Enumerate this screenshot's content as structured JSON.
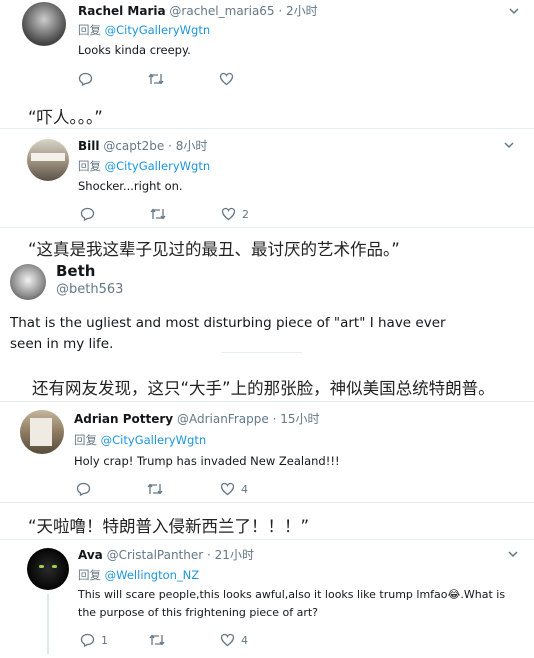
{
  "tweets": [
    {
      "name": "Rachel Maria",
      "handle": "@rachel_maria65",
      "time": "2小时",
      "reply_prefix": "回复",
      "reply_to": "@CityGalleryWgtn",
      "text": "Looks kinda creepy.",
      "reply_count": "",
      "like_count": ""
    },
    {
      "name": "Bill",
      "handle": "@capt2be",
      "time": "8小时",
      "reply_prefix": "回复",
      "reply_to": "@CityGalleryWgtn",
      "text": "Shocker...right on.",
      "reply_count": "",
      "like_count": "2"
    },
    {
      "name": "Beth",
      "handle": "@beth563",
      "text_line1": "That is the ugliest and most disturbing piece of \"art\" I have ever",
      "text_line2": "seen in my life."
    },
    {
      "name": "Adrian Pottery",
      "handle": "@AdrianFrappe",
      "time": "15小时",
      "reply_prefix": "回复",
      "reply_to": "@CityGalleryWgtn",
      "text": "Holy crap!  Trump has invaded New Zealand!!!",
      "reply_count": "",
      "like_count": "4"
    },
    {
      "name": "Ava",
      "handle": "@CristalPanther",
      "time": "21小时",
      "reply_prefix": "回复",
      "reply_to": "@Wellington_NZ",
      "text_line1": "This will scare people,this looks awful,also it looks like trump lmfao",
      "emoji": "😂",
      "text_line1b": ".What is",
      "text_line2": "the purpose of this frightening piece of art?",
      "reply_count": "1",
      "like_count": "4"
    }
  ],
  "captions": {
    "c1": "“吓人。。。”",
    "c2": "“这真是我这辈子见过的最丑、最讨厌的艺术作品。”",
    "c3": "还有网友发现，这只“大手”上的那张脸，神似美国总统特朗普。",
    "c4": "“天啦噜！特朗普入侵新西兰了！！！”"
  },
  "colors": {
    "link": "#1b95e0",
    "muted": "#657786",
    "text": "#14171a",
    "border": "#e6ecf0"
  }
}
